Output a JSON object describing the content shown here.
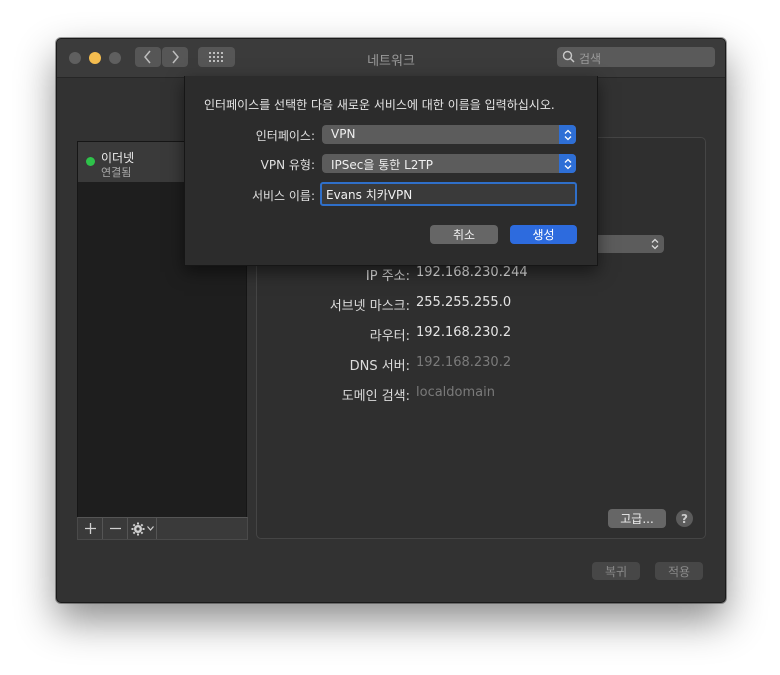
{
  "window": {
    "title": "네트워크",
    "search_placeholder": "검색"
  },
  "sidebar": {
    "items": [
      {
        "name": "이더넷",
        "status": "연결됨",
        "status_color": "#2ec24a"
      }
    ]
  },
  "details": {
    "ip_label": "IP 주소:",
    "ip_value": "192.168.230.244",
    "subnet_label": "서브넷 마스크:",
    "subnet_value": "255.255.255.0",
    "router_label": "라우터:",
    "router_value": "192.168.230.2",
    "dns_label": "DNS 서버:",
    "dns_value": "192.168.230.2",
    "domain_label": "도메인 검색:",
    "domain_value": "localdomain",
    "advanced_label": "고급...",
    "help_label": "?"
  },
  "footer": {
    "revert_label": "복귀",
    "apply_label": "적용"
  },
  "sheet": {
    "prompt": "인터페이스를 선택한 다음 새로운 서비스에 대한 이름을 입력하십시오.",
    "interface_label": "인터페이스:",
    "interface_value": "VPN",
    "vpn_type_label": "VPN 유형:",
    "vpn_type_value": "IPSec을 통한 L2TP",
    "service_name_label": "서비스 이름:",
    "service_name_value": "Evans 치카VPN",
    "cancel_label": "취소",
    "create_label": "생성",
    "accent_color": "#2d6bde"
  }
}
